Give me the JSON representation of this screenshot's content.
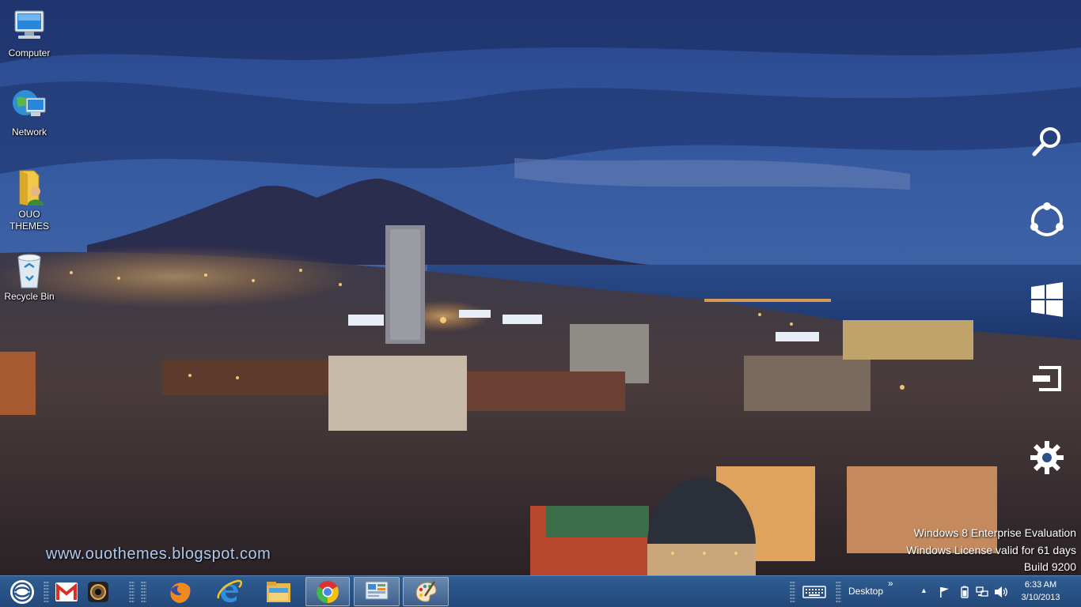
{
  "desktop": {
    "icons": [
      {
        "label": "Computer",
        "icon": "computer-icon"
      },
      {
        "label": "Network",
        "icon": "network-icon"
      },
      {
        "label": "OUO THEMES",
        "icon": "user-folder-icon"
      },
      {
        "label": "Recycle Bin",
        "icon": "recycle-bin-icon"
      }
    ]
  },
  "charms": [
    "search-icon",
    "share-icon",
    "start-icon",
    "devices-icon",
    "settings-icon"
  ],
  "watermark": {
    "line1": "Windows 8 Enterprise Evaluation",
    "line2": "Windows License valid for 61 days",
    "line3": "Build 9200"
  },
  "wallpaper_text": "www.ouothemes.blogspot.com",
  "taskbar": {
    "start_icon": "start-orb-icon",
    "pinned": [
      "gmail-icon",
      "camera-icon",
      "firefox-icon",
      "internet-explorer-icon",
      "file-explorer-icon",
      "chrome-icon",
      "control-panel-icon",
      "paint-icon"
    ],
    "toolbar_label": "Desktop",
    "toolbar_chevron": "»",
    "tray": {
      "show_hidden": "▲",
      "icons": [
        "flag-icon",
        "battery-icon",
        "network-tray-icon",
        "volume-icon"
      ]
    },
    "clock": {
      "time": "6:33 AM",
      "date": "3/10/2013"
    }
  },
  "colors": {
    "taskbar": "#2a5489",
    "sky_top": "#2c4b93",
    "sea": "#1f3a78"
  }
}
